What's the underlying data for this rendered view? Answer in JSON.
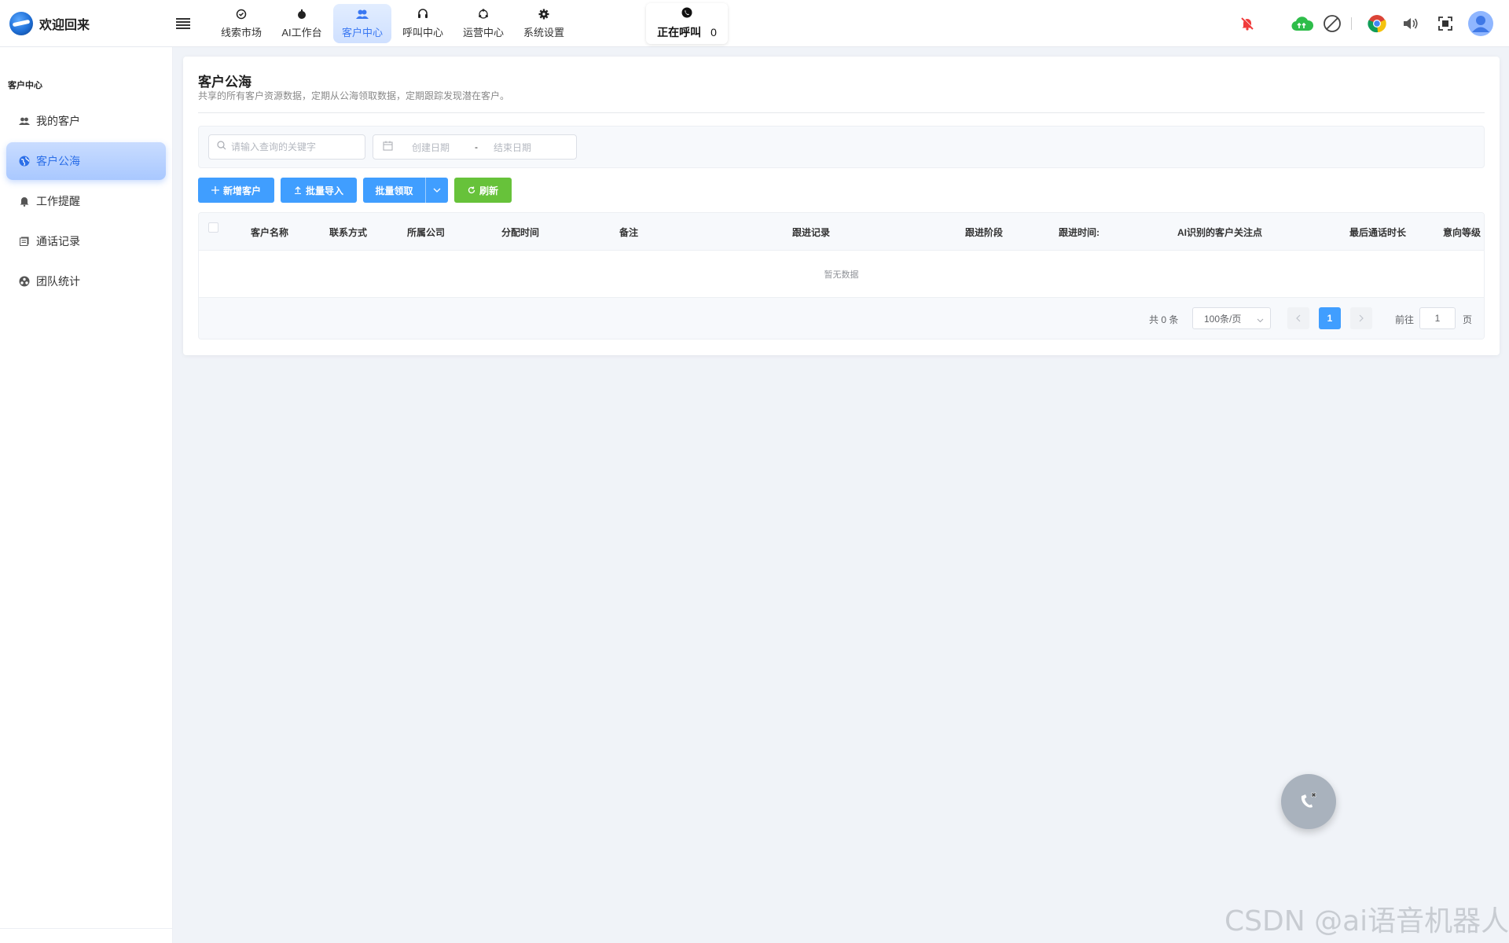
{
  "app": {
    "title": "欢迎回来"
  },
  "nav": {
    "items": [
      {
        "label": "线索市场",
        "icon": "clock-check-icon"
      },
      {
        "label": "AI工作台",
        "icon": "bot-icon"
      },
      {
        "label": "客户中心",
        "icon": "users-icon"
      },
      {
        "label": "呼叫中心",
        "icon": "headset-icon"
      },
      {
        "label": "运营中心",
        "icon": "cycle-icon"
      },
      {
        "label": "系统设置",
        "icon": "gear-icon"
      }
    ],
    "active": "客户中心"
  },
  "calling": {
    "label": "正在呼叫",
    "count": "0"
  },
  "sidebar": {
    "title": "客户中心",
    "items": [
      {
        "label": "我的客户",
        "icon": "people-icon"
      },
      {
        "label": "客户公海",
        "icon": "globe-icon"
      },
      {
        "label": "工作提醒",
        "icon": "bell-icon"
      },
      {
        "label": "通话记录",
        "icon": "record-icon"
      },
      {
        "label": "团队统计",
        "icon": "team-icon"
      }
    ],
    "active": "客户公海"
  },
  "page": {
    "title": "客户公海",
    "subtitle": "共享的所有客户资源数据，定期从公海领取数据，定期跟踪发现潜在客户。"
  },
  "filter": {
    "search_placeholder": "请输入查询的关键字",
    "date_start_placeholder": "创建日期",
    "date_sep": "-",
    "date_end_placeholder": "结束日期"
  },
  "toolbar": {
    "add": "新增客户",
    "import": "批量导入",
    "claim": "批量领取",
    "refresh": "刷新"
  },
  "table": {
    "columns": [
      "客户名称",
      "联系方式",
      "所属公司",
      "分配时间",
      "备注",
      "跟进记录",
      "跟进阶段",
      "跟进时间:",
      "AI识别的客户关注点",
      "最后通话时长",
      "意向等级"
    ],
    "empty_text": "暂无数据"
  },
  "pagination": {
    "total": "共 0 条",
    "page_size": "100条/页",
    "current_page": "1",
    "goto_label": "前往",
    "goto_value": "1",
    "goto_suffix": "页"
  },
  "colors": {
    "accent": "#409eff",
    "success": "#67c23a",
    "active_nav": "#3a78f2"
  },
  "watermark": "CSDN @ai语音机器人"
}
